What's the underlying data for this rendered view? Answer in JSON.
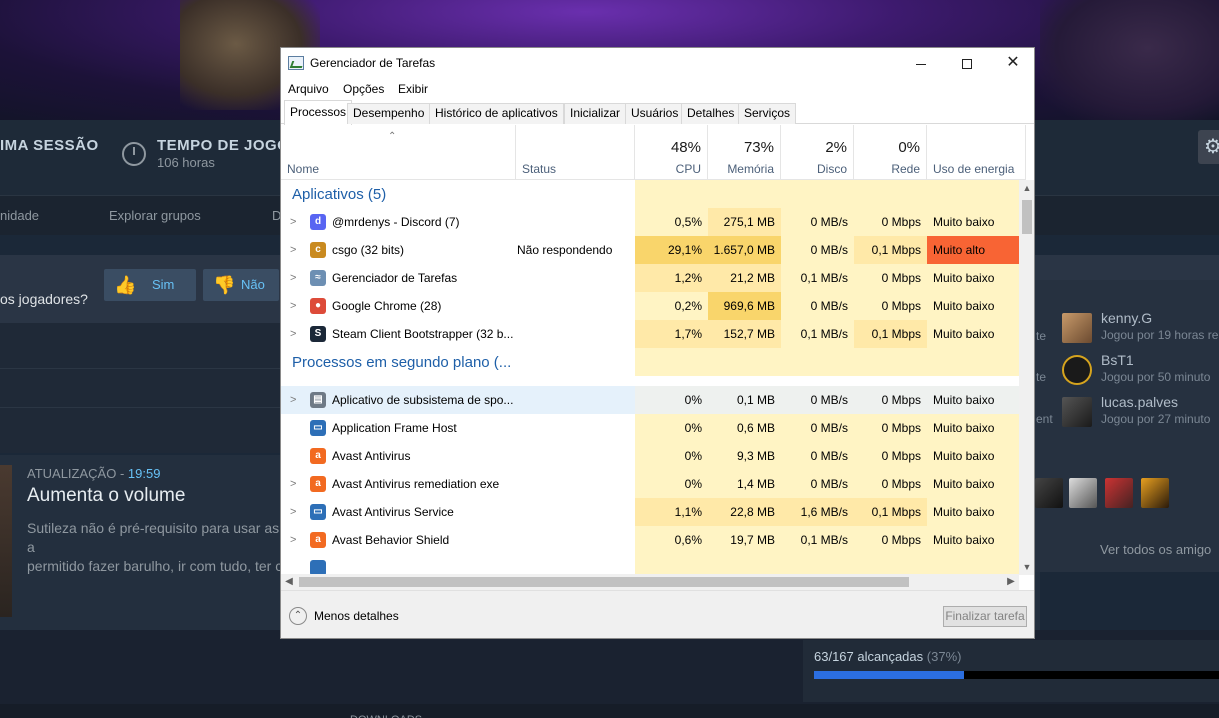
{
  "steam": {
    "stat_last_session": "IMA SESSÃO",
    "stat_playtime_label": "TEMPO DE JOGO",
    "stat_playtime_value": "106 horas",
    "nav": [
      "nidade",
      "Explorar grupos",
      "D"
    ],
    "question": "os jogadores?",
    "vote_yes": "Sim",
    "vote_no": "Não",
    "news_tag": "ATUALIZAÇÃO",
    "news_sep": " - ",
    "news_time": "19:59",
    "news_title": "Aumenta o volume",
    "news_body_1": "Sutileza não é pré-requisito para usar as a",
    "news_body_2": "permitido fazer barulho, ir com tudo, ter c",
    "friends": [
      {
        "name": "kenny.G",
        "status": "Jogou por 19 horas re",
        "side": "te"
      },
      {
        "name": "BsT1",
        "status": "Jogou por 50 minuto",
        "side": "te"
      },
      {
        "name": "lucas.palves",
        "status": "Jogou por 27 minuto",
        "side": "ent"
      }
    ],
    "see_all": "Ver todos os amigo",
    "achievements": "63/167 alcançadas",
    "achievements_pct": "(37%)",
    "achievements_fraction": 0.37,
    "bottom_text": "DOWNLOADS"
  },
  "taskmgr": {
    "title": "Gerenciador de Tarefas",
    "menu": [
      "Arquivo",
      "Opções",
      "Exibir"
    ],
    "tabs": [
      "Processos",
      "Desempenho",
      "Histórico de aplicativos",
      "Inicializar",
      "Usuários",
      "Detalhes",
      "Serviços"
    ],
    "header": {
      "name": "Nome",
      "status": "Status",
      "cpu_pct": "48%",
      "cpu": "CPU",
      "mem_pct": "73%",
      "mem": "Memória",
      "disk_pct": "2%",
      "disk": "Disco",
      "net_pct": "0%",
      "net": "Rede",
      "power": "Uso de energia"
    },
    "group_apps": "Aplicativos (5)",
    "group_bg": "Processos em segundo plano (...",
    "apps": [
      {
        "name": "@mrdenys - Discord (7)",
        "status": "",
        "cpu": "0,5%",
        "mem": "275,1 MB",
        "disk": "0 MB/s",
        "net": "0 Mbps",
        "power": "Muito baixo"
      },
      {
        "name": "csgo (32 bits)",
        "status": "Não respondendo",
        "cpu": "29,1%",
        "mem": "1.657,0 MB",
        "disk": "0 MB/s",
        "net": "0,1 Mbps",
        "power": "Muito alto"
      },
      {
        "name": "Gerenciador de Tarefas",
        "status": "",
        "cpu": "1,2%",
        "mem": "21,2 MB",
        "disk": "0,1 MB/s",
        "net": "0 Mbps",
        "power": "Muito baixo"
      },
      {
        "name": "Google Chrome (28)",
        "status": "",
        "cpu": "0,2%",
        "mem": "969,6 MB",
        "disk": "0 MB/s",
        "net": "0 Mbps",
        "power": "Muito baixo"
      },
      {
        "name": "Steam Client Bootstrapper (32 b...",
        "status": "",
        "cpu": "1,7%",
        "mem": "152,7 MB",
        "disk": "0,1 MB/s",
        "net": "0,1 Mbps",
        "power": "Muito baixo"
      }
    ],
    "background": [
      {
        "name": "Aplicativo de subsistema de spo...",
        "cpu": "0%",
        "mem": "0,1 MB",
        "disk": "0 MB/s",
        "net": "0 Mbps",
        "power": "Muito baixo"
      },
      {
        "name": "Application Frame Host",
        "cpu": "0%",
        "mem": "0,6 MB",
        "disk": "0 MB/s",
        "net": "0 Mbps",
        "power": "Muito baixo"
      },
      {
        "name": "Avast Antivirus",
        "cpu": "0%",
        "mem": "9,3 MB",
        "disk": "0 MB/s",
        "net": "0 Mbps",
        "power": "Muito baixo"
      },
      {
        "name": "Avast Antivirus  remediation exe",
        "cpu": "0%",
        "mem": "1,4 MB",
        "disk": "0 MB/s",
        "net": "0 Mbps",
        "power": "Muito baixo"
      },
      {
        "name": "Avast Antivirus  Service",
        "cpu": "1,1%",
        "mem": "22,8 MB",
        "disk": "1,6 MB/s",
        "net": "0,1 Mbps",
        "power": "Muito baixo"
      },
      {
        "name": "Avast Behavior Shield",
        "cpu": "0,6%",
        "mem": "19,7 MB",
        "disk": "0,1 MB/s",
        "net": "0 Mbps",
        "power": "Muito baixo"
      }
    ],
    "less_details": "Menos detalhes",
    "end_task": "Finalizar tarefa",
    "colors": {
      "very_low": "#fff4c4",
      "mid": "#ffe9a8",
      "high": "#f9d56b",
      "alert": "#f86434",
      "group": "#1e5fa8"
    }
  }
}
